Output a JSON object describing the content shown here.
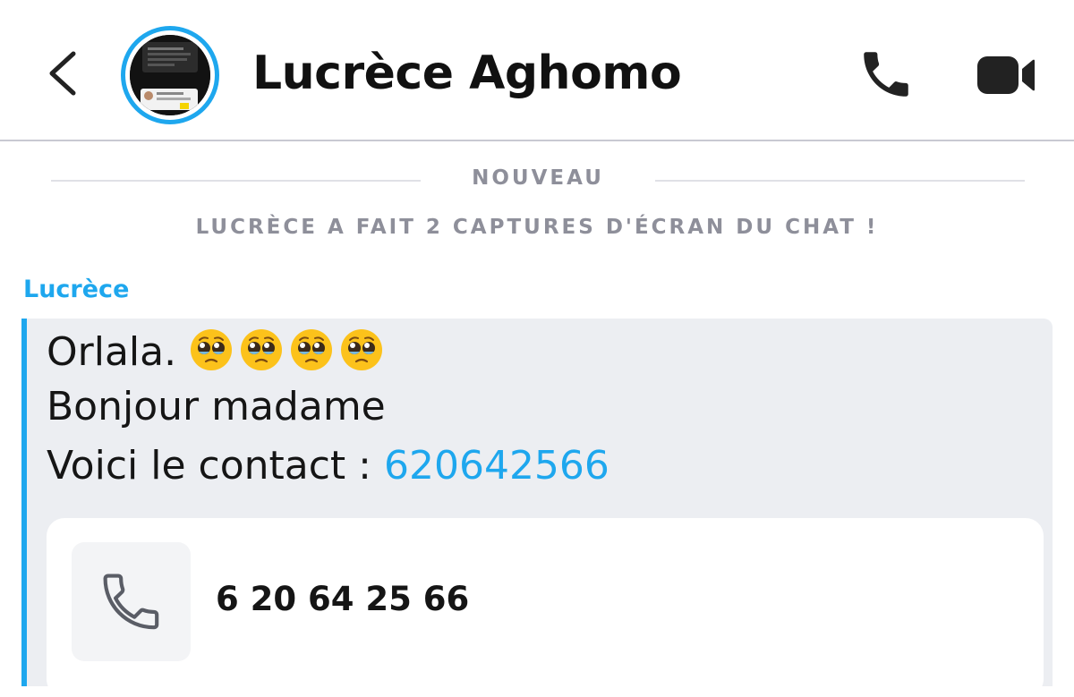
{
  "header": {
    "contact_name": "Lucrèce Aghomo",
    "back_icon": "chevron-left-icon",
    "call_icon": "phone-icon",
    "video_icon": "video-camera-icon",
    "avatar_ring_color": "#1ea7ee"
  },
  "chat": {
    "new_divider": "NOUVEAU",
    "screenshot_notice": "LUCRÈCE A FAIT 2 CAPTURES D'ÉCRAN DU CHAT !",
    "sender": "Lucrèce",
    "accent_color": "#1ea7ee",
    "message": {
      "line1_text": "Orlala.",
      "line1_emojis": [
        "pleading-face-emoji",
        "pleading-face-emoji",
        "pleading-face-emoji",
        "pleading-face-emoji"
      ],
      "line2_text": "Bonjour madame",
      "line3_prefix": "Voici le contact : ",
      "line3_link": "620642566"
    },
    "contact_card": {
      "icon": "phone-icon",
      "number": "6 20 64 25 66"
    }
  }
}
